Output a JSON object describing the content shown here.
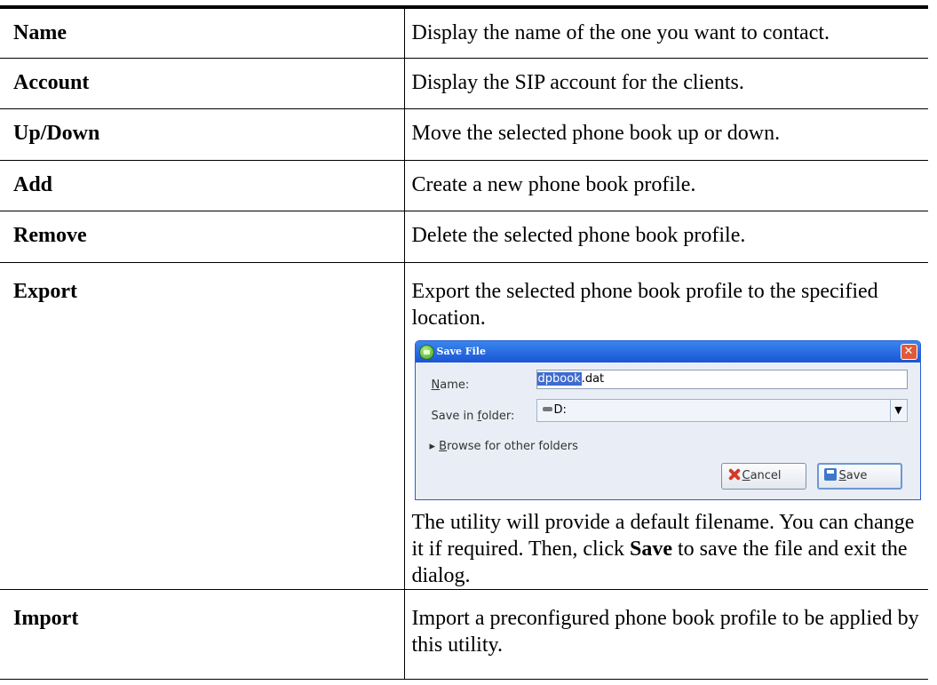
{
  "rows": [
    {
      "term": "Name",
      "definition": "Display the name of the one you want to contact."
    },
    {
      "term": "Account",
      "definition": "Display the SIP account for the clients."
    },
    {
      "term": "Up/Down",
      "definition": "Move the selected phone book up or down."
    },
    {
      "term": "Add",
      "definition": "Create a new phone book profile."
    },
    {
      "term": "Remove",
      "definition": "Delete the selected phone book profile."
    },
    {
      "term": "Export",
      "definition": "Export the selected phone book profile to the specified location.",
      "note_before": "The utility will provide a default filename. You can change it if required. Then, click ",
      "note_bold": "Save",
      "note_after": " to save the file and exit the dialog."
    },
    {
      "term": "Import",
      "definition": "Import a preconfigured phone book profile to be applied by this utility."
    }
  ],
  "dialog": {
    "title": "Save File",
    "close_glyph": "✕",
    "name_label_mnemonic": "N",
    "name_label_rest": "ame:",
    "filename_selected": "dpbook",
    "filename_ext": ".dat",
    "folder_label_before": "Save in ",
    "folder_label_mnemonic": "f",
    "folder_label_after": "older:",
    "folder_value": "D:",
    "dropdown_glyph": "▼",
    "expander_arrow": "▸",
    "browse_mnemonic": "B",
    "browse_rest": "rowse for other folders",
    "cancel_mnemonic": "C",
    "cancel_rest": "ancel",
    "save_mnemonic": "S",
    "save_rest": "ave"
  }
}
